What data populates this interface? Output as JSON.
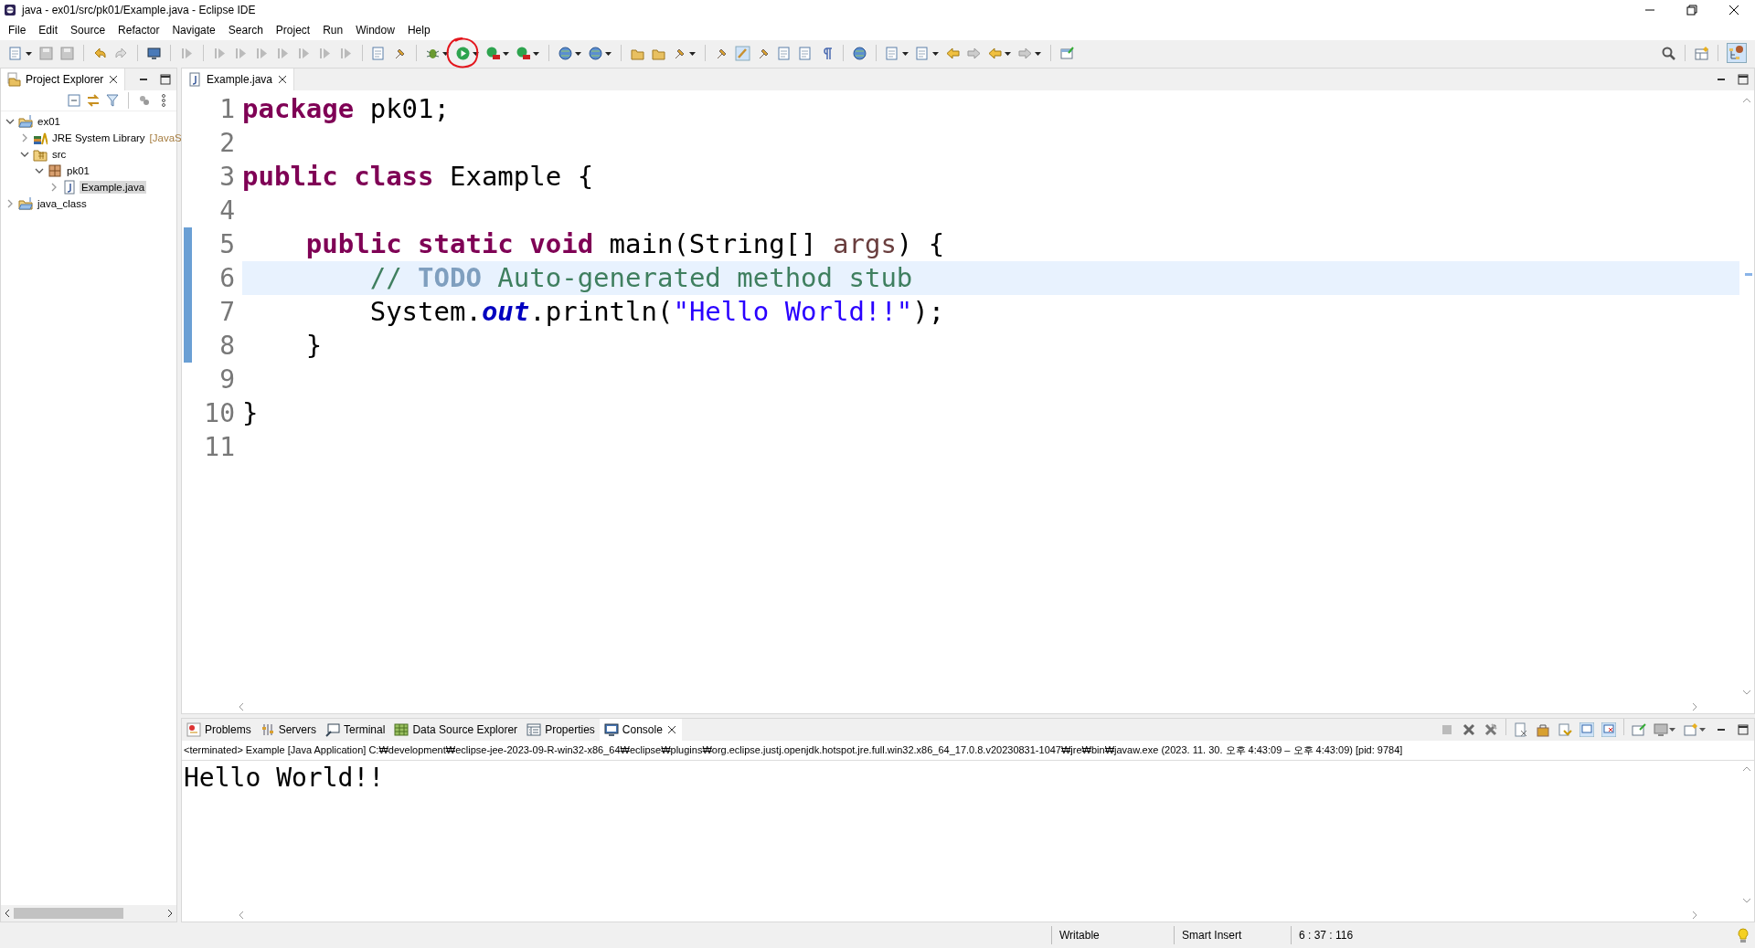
{
  "window": {
    "title": "java - ex01/src/pk01/Example.java - Eclipse IDE"
  },
  "menu": [
    "File",
    "Edit",
    "Source",
    "Refactor",
    "Navigate",
    "Search",
    "Project",
    "Run",
    "Window",
    "Help"
  ],
  "explorer": {
    "title": "Project Explorer",
    "tree": [
      {
        "label": "ex01",
        "kind": "project",
        "expanded": true,
        "selected": false,
        "children": [
          {
            "label": "JRE System Library",
            "suffix": "[JavaS",
            "kind": "library",
            "expanded": false,
            "selected": false
          },
          {
            "label": "src",
            "kind": "folder",
            "expanded": true,
            "selected": false,
            "children": [
              {
                "label": "pk01",
                "kind": "package",
                "expanded": true,
                "selected": false,
                "children": [
                  {
                    "label": "Example.java",
                    "kind": "file",
                    "expanded": false,
                    "selected": true
                  }
                ]
              }
            ]
          }
        ]
      },
      {
        "label": "java_class",
        "kind": "project",
        "expanded": false,
        "selected": false
      }
    ]
  },
  "editor": {
    "tab": "Example.java",
    "lines": [
      {
        "number": "1",
        "current": false,
        "tokens": [
          {
            "kind": "keyword",
            "text": "package"
          },
          {
            "kind": "plain",
            "text": " pk01;"
          }
        ]
      },
      {
        "number": "2",
        "current": false
      },
      {
        "number": "3",
        "current": false,
        "tokens": [
          {
            "kind": "keyword",
            "text": "public class"
          },
          {
            "kind": "plain",
            "text": " Example {"
          }
        ]
      },
      {
        "number": "4",
        "current": false
      },
      {
        "number": "5",
        "current": false,
        "tokens": [
          {
            "kind": "keyword",
            "text": "    public static void"
          },
          {
            "kind": "plain",
            "text": " main(String[] "
          },
          {
            "kind": "param",
            "text": "args"
          },
          {
            "kind": "plain",
            "text": ") {"
          }
        ]
      },
      {
        "number": "6",
        "current": true,
        "tokens": [
          {
            "kind": "comment",
            "text": "        // "
          },
          {
            "kind": "todo",
            "text": "TODO"
          },
          {
            "kind": "comment",
            "text": " Auto-generated method stub"
          }
        ]
      },
      {
        "number": "7",
        "current": false,
        "tokens": [
          {
            "kind": "plain",
            "text": "        System."
          },
          {
            "kind": "field",
            "text": "out"
          },
          {
            "kind": "plain",
            "text": ".println("
          },
          {
            "kind": "string",
            "text": "\"Hello World!!\""
          },
          {
            "kind": "plain",
            "text": ");"
          }
        ]
      },
      {
        "number": "8",
        "current": false,
        "tokens": [
          {
            "kind": "plain",
            "text": "    }"
          }
        ]
      },
      {
        "number": "9",
        "current": false
      },
      {
        "number": "10",
        "current": false,
        "tokens": [
          {
            "kind": "plain",
            "text": "}"
          }
        ]
      },
      {
        "number": "11",
        "current": false
      }
    ]
  },
  "bottom_tabs": [
    {
      "label": "Problems",
      "selected": false
    },
    {
      "label": "Servers",
      "selected": false
    },
    {
      "label": "Terminal",
      "selected": false
    },
    {
      "label": "Data Source Explorer",
      "selected": false
    },
    {
      "label": "Properties",
      "selected": false
    },
    {
      "label": "Console",
      "selected": true
    }
  ],
  "console": {
    "header": "<terminated> Example [Java Application] C:₩development₩eclipse-jee-2023-09-R-win32-x86_64₩eclipse₩plugins₩org.eclipse.justj.openjdk.hotspot.jre.full.win32.x86_64_17.0.8.v20230831-1047₩jre₩bin₩javaw.exe  (2023. 11. 30. 오후 4:43:09 – 오후 4:43:09) [pid: 9784]",
    "output": "Hello World!!"
  },
  "status_bar": [
    "Writable",
    "Smart Insert",
    "6 : 37 : 116"
  ]
}
